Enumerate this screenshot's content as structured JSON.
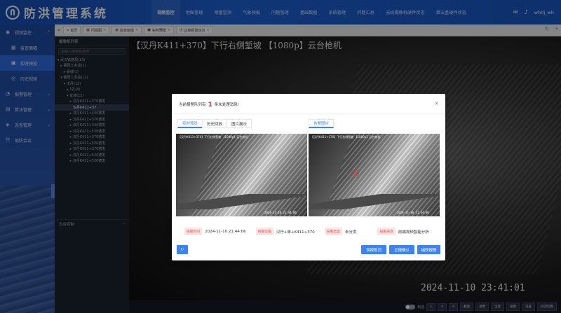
{
  "header": {
    "title": "防洪管理系统",
    "nav": [
      "视频监控",
      "地图管理",
      "雨量监测",
      "气象预报",
      "问题管理",
      "基础数据",
      "系统管理",
      "问题汇总",
      "无线摄像机硬件状态",
      "算法盒硬件状态"
    ],
    "user": "whtlj_wh"
  },
  "sidebar": {
    "items": [
      {
        "label": "视频监控",
        "icon": "camera-icon",
        "type": "parent"
      },
      {
        "label": "监查面幅",
        "icon": "grid-icon",
        "type": "child"
      },
      {
        "label": "实时预览",
        "icon": "video-icon",
        "type": "child",
        "active": true
      },
      {
        "label": "历史视频",
        "icon": "eye-icon",
        "type": "child"
      },
      {
        "label": "报警管理",
        "icon": "alarm-icon",
        "type": "parent"
      },
      {
        "label": "算法管理",
        "icon": "chip-icon",
        "type": "parent"
      },
      {
        "label": "巡查管理",
        "icon": "patrol-icon",
        "type": "parent"
      },
      {
        "label": "助防会议",
        "icon": "meeting-icon",
        "type": "parent"
      }
    ]
  },
  "tabs": [
    {
      "label": "首页",
      "icon": "home-icon"
    },
    {
      "label": "问题图",
      "icon": "grid-icon"
    },
    {
      "label": "监查面幅",
      "icon": "grid-icon"
    },
    {
      "label": "实时预览",
      "icon": "video-icon",
      "active": true
    },
    {
      "label": "边坡报警信息",
      "icon": "alarm-icon"
    }
  ],
  "tree": {
    "header": "摄像机列表",
    "search_placeholder": "请输入摄像机名称",
    "rows": [
      "▾ 武汉铁路局(13)",
      "  ▸ 襄阳工务段(1)",
      "    ▸ 襄城(1)",
      "  ▾ 襄阳工务段(12)",
      "    ▾ 汉丹(12)",
      "      ▸ 1孔(0)",
      "      ▾ 宜城(12)",
      "        ▸ 汉丹K411+370德发",
      "          汉丹K411+37",
      "        ▸ 汉丹K411+430德发",
      "        ▸ 汉丹K411+370德发",
      "        ▸ 汉丹K411+430德发",
      "        ▸ 汉丹K411+530德发",
      "        ▸ 汉丹K411+370德发",
      "        ▸ 汉丹K411+530德发",
      "        ▸ 汉丹K411+370德发",
      "        ▸ 汉丹K411+530德发",
      "        ▸ 汉丹K411+530德发"
    ],
    "selected_index": 8,
    "footer": "云台控制"
  },
  "video": {
    "title": "【汉丹K411+370】下行右侧堑坡 【1080p】云台枪机",
    "timestamp": "2024-11-10 23:41:01"
  },
  "playbar": {
    "toggle_label": "轮巡",
    "buttons": [
      "1",
      "4",
      "9",
      "截图",
      "录像",
      "全屏",
      "录像",
      "设置",
      "码流切换"
    ]
  },
  "modal": {
    "head_prefix": "当前报警队列有",
    "count": "1",
    "head_suffix": "条未处理消息!",
    "tabs": [
      "实时预览",
      "历史回放",
      "图片展示"
    ],
    "right_tab": "告警图片",
    "left_caption": "【汉丹K411+370】下行右侧堑坡 【1080p】云台枪机",
    "right_caption": "【汉丹K411+370】下行右侧堑坡 【1080p】云台枪机",
    "image_time": "2024-11-10 21:44:06",
    "info": [
      {
        "tag": "报警时间",
        "value": "2024-11-10 21:44:06"
      },
      {
        "tag": "报警位置",
        "value": "汉丹+单+K411+370"
      },
      {
        "tag": "报警类型",
        "value": "未分类"
      },
      {
        "tag": "报警来源",
        "value": "前端视频智能分析"
      }
    ],
    "buttons": {
      "left_icon": "refresh-icon",
      "ignore": "误报取消",
      "confirm": "正报确认",
      "close": "捕获报警"
    }
  }
}
